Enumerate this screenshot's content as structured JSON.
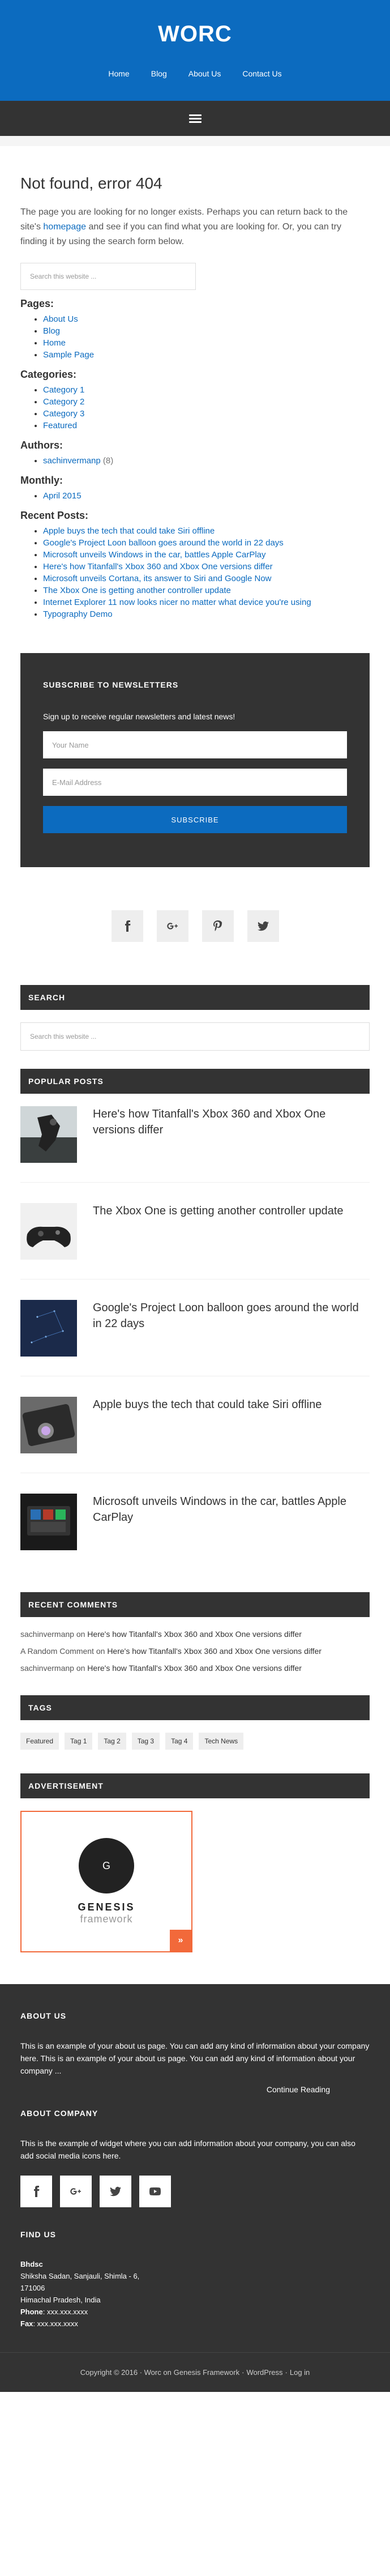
{
  "site": {
    "title": "WORC"
  },
  "nav": [
    "Home",
    "Blog",
    "About Us",
    "Contact Us"
  ],
  "page": {
    "title": "Not found, error 404",
    "intro_before": "The page you are looking for no longer exists. Perhaps you can return back to the site's ",
    "intro_link": "homepage",
    "intro_after": " and see if you can find what you are looking for. Or, you can try finding it by using the search form below.",
    "search_placeholder": "Search this website ..."
  },
  "sections": {
    "pages": {
      "heading": "Pages:",
      "items": [
        "About Us",
        "Blog",
        "Home",
        "Sample Page"
      ]
    },
    "categories": {
      "heading": "Categories:",
      "items": [
        "Category 1",
        "Category 2",
        "Category 3",
        "Featured"
      ]
    },
    "authors": {
      "heading": "Authors:",
      "name": "sachinvermanp",
      "count": "(8)"
    },
    "monthly": {
      "heading": "Monthly:",
      "items": [
        "April 2015"
      ]
    },
    "recent": {
      "heading": "Recent Posts:",
      "items": [
        "Apple buys the tech that could take Siri offline",
        "Google's Project Loon balloon goes around the world in 22 days",
        "Microsoft unveils Windows in the car, battles Apple CarPlay",
        "Here's how Titanfall's Xbox 360 and Xbox One versions differ",
        "Microsoft unveils Cortana, its answer to Siri and Google Now",
        "The Xbox One is getting another controller update",
        "Internet Explorer 11 now looks nicer no matter what device you're using",
        "Typography Demo"
      ]
    }
  },
  "newsletter": {
    "title": "SUBSCRIBE TO NEWSLETTERS",
    "text": "Sign up to receive regular newsletters and latest news!",
    "name_placeholder": "Your Name",
    "email_placeholder": "E-Mail Address",
    "button": "SUBSCRIBE"
  },
  "social": [
    "facebook-icon",
    "google-plus-icon",
    "pinterest-icon",
    "twitter-icon"
  ],
  "widgets": {
    "search_title": "SEARCH",
    "search_placeholder": "Search this website ...",
    "popular_title": "POPULAR POSTS",
    "popular": [
      "Here's how Titanfall's Xbox 360 and Xbox One versions differ",
      "The Xbox One is getting another controller update",
      "Google's Project Loon balloon goes around the world in 22 days",
      "Apple buys the tech that could take Siri offline",
      "Microsoft unveils Windows in the car, battles Apple CarPlay"
    ],
    "comments_title": "RECENT COMMENTS",
    "comments": [
      {
        "author": "sachinvermanp",
        "on": "on",
        "post": "Here's how Titanfall's Xbox 360 and Xbox One versions differ"
      },
      {
        "author": "A Random Comment",
        "on": "on",
        "post": "Here's how Titanfall's Xbox 360 and Xbox One versions differ"
      },
      {
        "author": "sachinvermanp",
        "on": "on",
        "post": "Here's how Titanfall's Xbox 360 and Xbox One versions differ"
      }
    ],
    "tags_title": "TAGS",
    "tags": [
      "Featured",
      "Tag 1",
      "Tag 2",
      "Tag 3",
      "Tag 4",
      "Tech News"
    ],
    "ad_title": "ADVERTISEMENT",
    "ad_logo": "G",
    "ad_name": "GENESIS",
    "ad_sub": "framework",
    "ad_arrow": "»"
  },
  "footer": {
    "about_title": "ABOUT US",
    "about_text": "This is an example of your about us page. You can add any kind of information about your company here. This is an example of your about us page. You can add any kind of information about your company ...",
    "continue": "Continue Reading",
    "company_title": "ABOUT COMPANY",
    "company_text": "This is the example of widget where you can add information about your company, you can also add social media icons here.",
    "social": [
      "facebook-icon",
      "google-plus-icon",
      "twitter-icon",
      "youtube-icon"
    ],
    "find_title": "FIND US",
    "addr_name": "Bhdsc",
    "addr_line1": "Shiksha Sadan, Sanjauli, Shimla - 6,",
    "addr_line2": "171006",
    "addr_line3": "Himachal Pradesh, India",
    "phone_label": "Phone",
    "phone": ": xxx.xxx.xxxx",
    "fax_label": "Fax",
    "fax": ": xxx.xxx.xxxx"
  },
  "bottom": {
    "copyright": "Copyright © 2016 · Worc on",
    "genesis": "Genesis Framework",
    "sep": "·",
    "wordpress": "WordPress",
    "sep2": "·",
    "login": "Log in"
  },
  "colors": {
    "brand": "#0c6bbf",
    "dark": "#333333",
    "accent": "#f2693a"
  }
}
